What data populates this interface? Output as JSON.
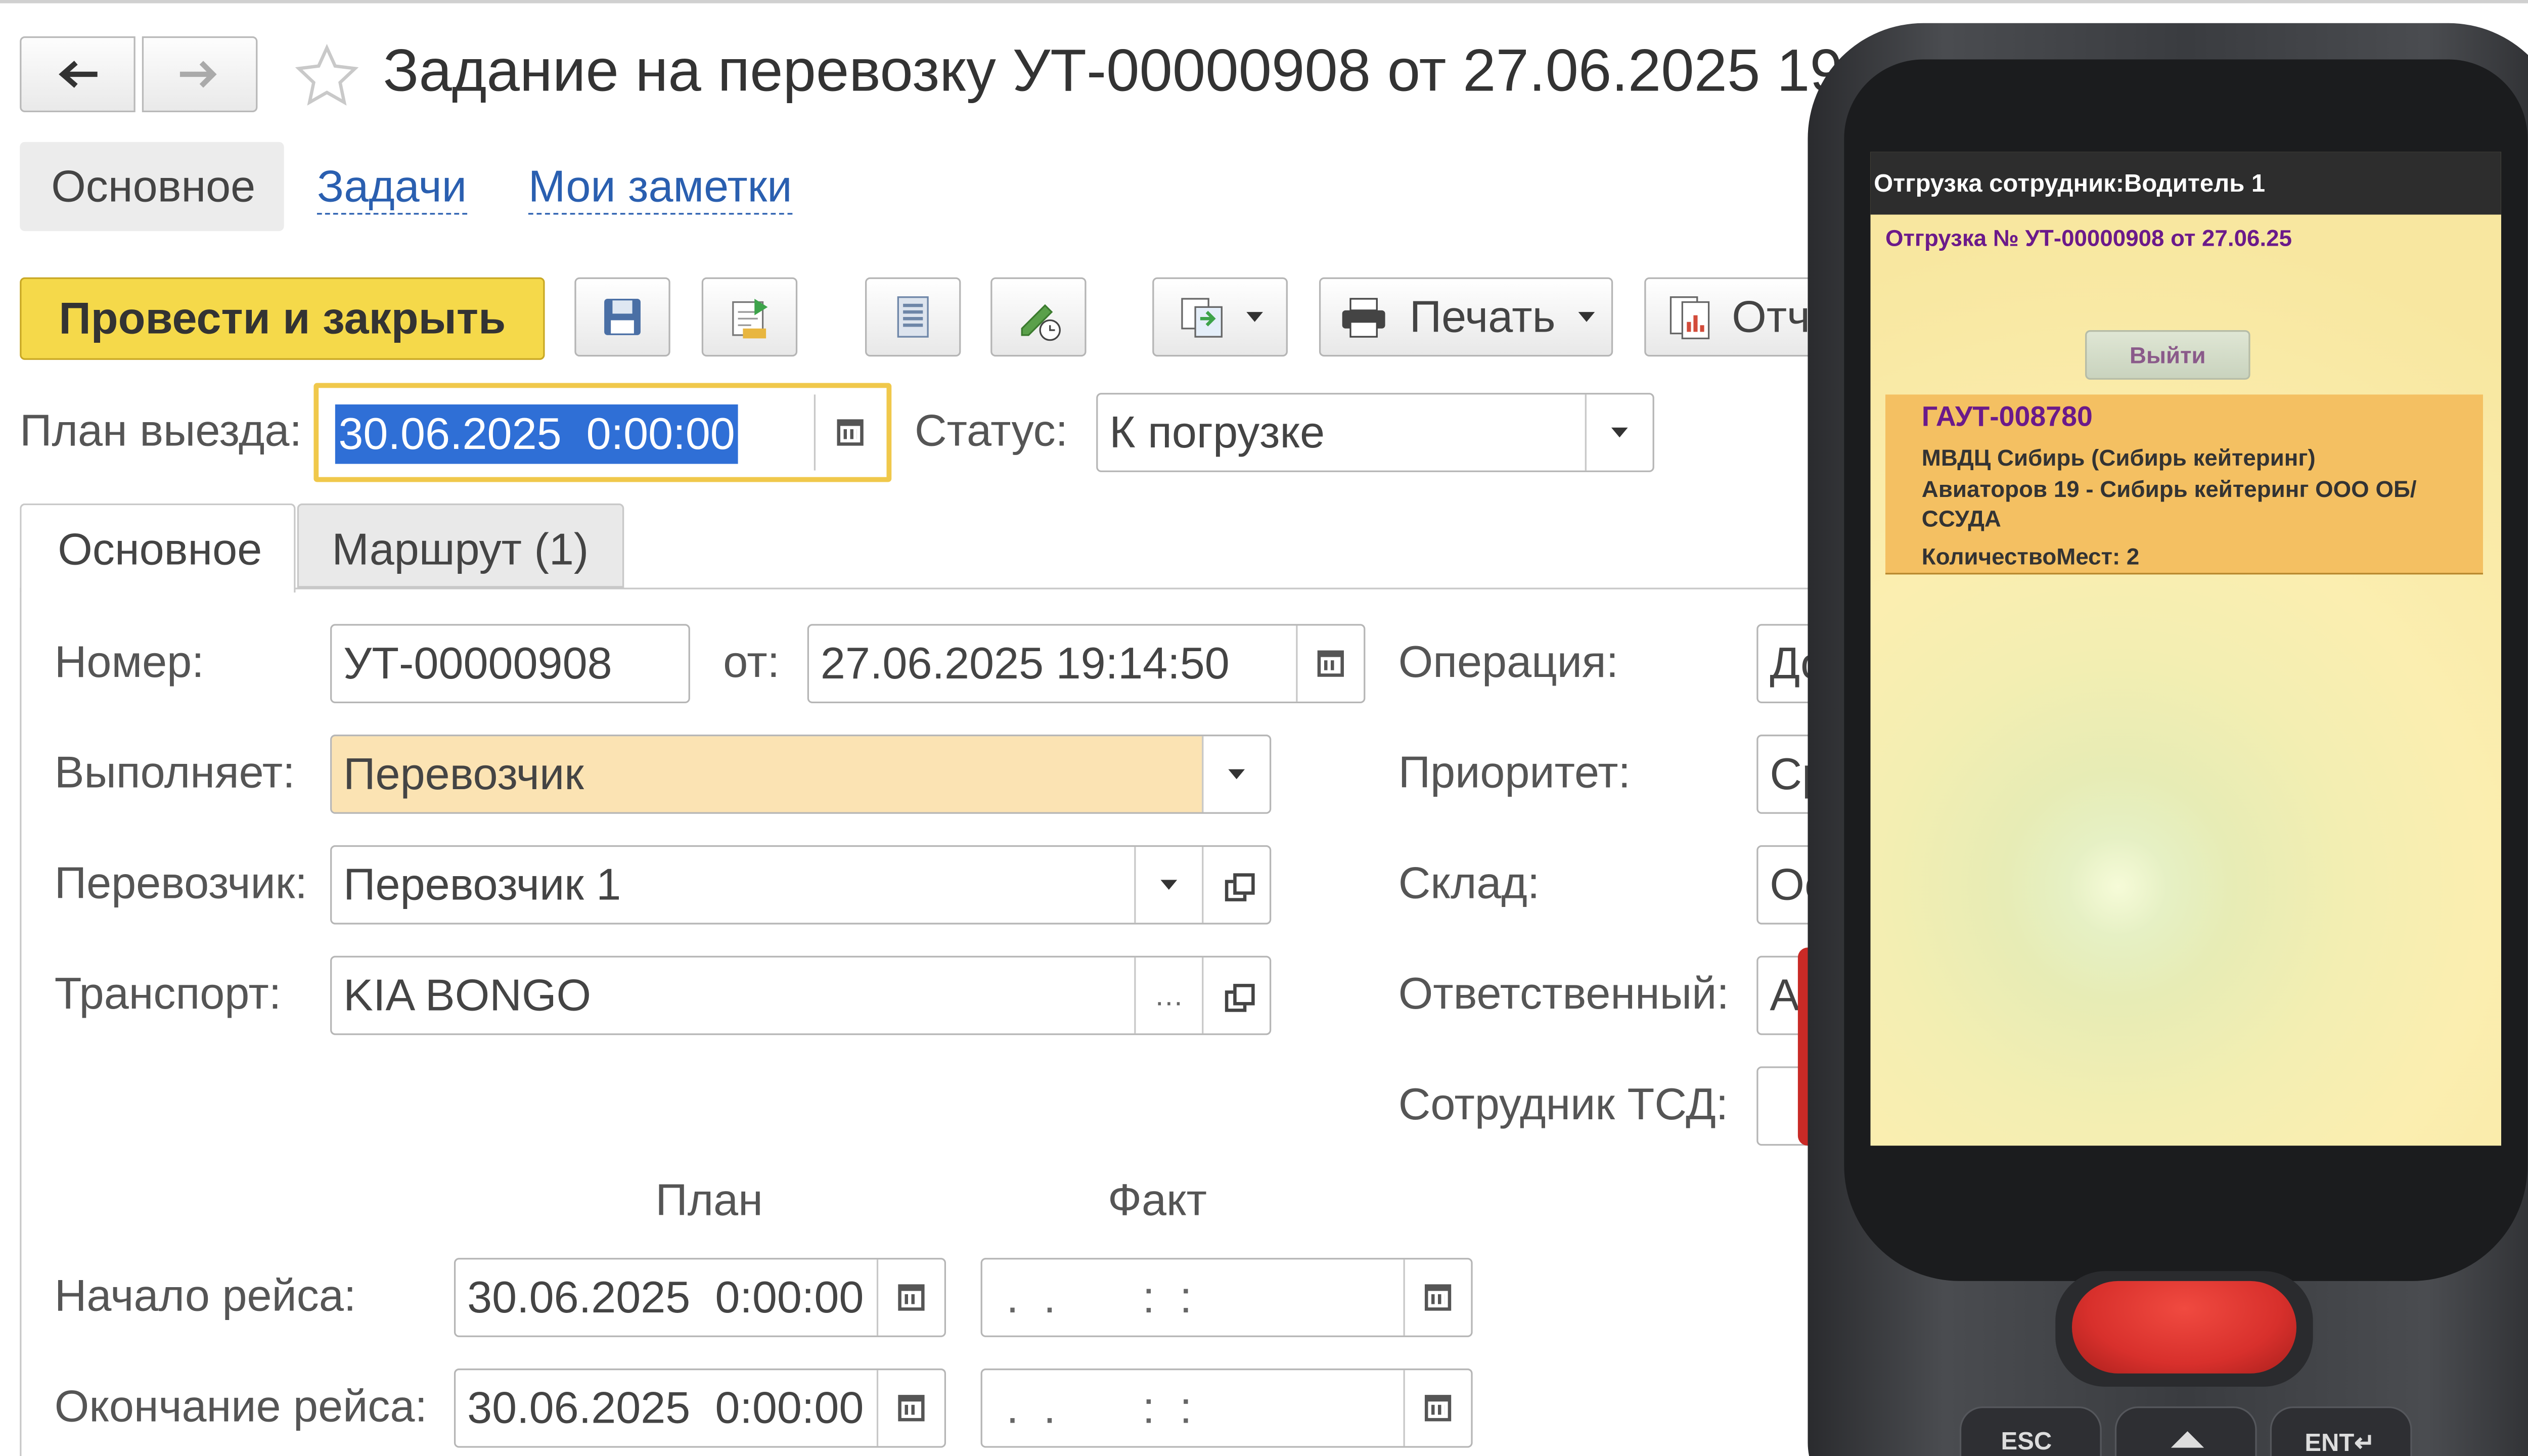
{
  "window": {
    "title": "Задание на перевозку УТ-00000908 от 27.06.2025 19"
  },
  "nav": {
    "back_icon": "arrow-left-icon",
    "forward_icon": "arrow-right-icon",
    "favorite_icon": "star-icon"
  },
  "top_tabs": [
    {
      "label": "Основное"
    },
    {
      "label": "Задачи"
    },
    {
      "label": "Мои заметки"
    }
  ],
  "toolbar": {
    "post_close_label": "Провести и закрыть",
    "print_label": "Печать",
    "reports_label": "Отч"
  },
  "header_fields": {
    "plan_label": "План выезда:",
    "plan_value": "30.06.2025  0:00:00",
    "status_label": "Статус:",
    "status_value": "К погрузке"
  },
  "form_tabs": [
    {
      "label": "Основное"
    },
    {
      "label": "Маршрут (1)"
    }
  ],
  "form": {
    "number_label": "Номер:",
    "number_value": "УТ-00000908",
    "from_label": "от:",
    "date_value": "27.06.2025 19:14:50",
    "executor_label": "Выполняет:",
    "executor_value": "Перевозчик",
    "carrier_label": "Перевозчик:",
    "carrier_value": "Перевозчик 1",
    "transport_label": "Транспорт:",
    "transport_value": "KIA BONGO",
    "operation_label": "Операция:",
    "operation_value": "До",
    "priority_label": "Приоритет:",
    "priority_value": "Ср",
    "warehouse_label": "Склад:",
    "warehouse_value": "Ос",
    "responsible_label": "Ответственный:",
    "responsible_value": "Ал",
    "tsd_label": "Сотрудник ТСД:",
    "tsd_value": "",
    "plan_header": "План",
    "fact_header": "Факт",
    "trip_start_label": "Начало рейса:",
    "trip_start_plan": "30.06.2025  0:00:00",
    "trip_start_fact": " .  .       :  :",
    "trip_end_label": "Окончание рейса:",
    "trip_end_plan": "30.06.2025  0:00:00",
    "trip_end_fact": " .  .       :  :"
  },
  "device": {
    "header": "Отгрузка сотрудник:Водитель 1",
    "subtitle": "Отгрузка № УТ-00000908 от 27.06.25",
    "exit_label": "Выйти",
    "item": {
      "code": "ГАУТ-008780",
      "line1": "МВДЦ Сибирь (Сибирь кейтеринг)",
      "line2": "Авиаторов 19 - Сибирь кейтеринг ООО ОБ/",
      "line3": "ССУДА",
      "qty": "КоличествоМест: 2"
    },
    "keys": {
      "esc": "ESC",
      "ent": "ENT↵"
    }
  },
  "colors": {
    "accent_yellow": "#f5d94a",
    "focus_border": "#f0c84b",
    "link_blue": "#2a5fb0",
    "executor_fill": "#fbe3b3",
    "device_screen": "#fbeeb0",
    "device_item": "#f4c062",
    "device_text_purple": "#6b1a8a",
    "scanner_red": "#d8302c"
  }
}
